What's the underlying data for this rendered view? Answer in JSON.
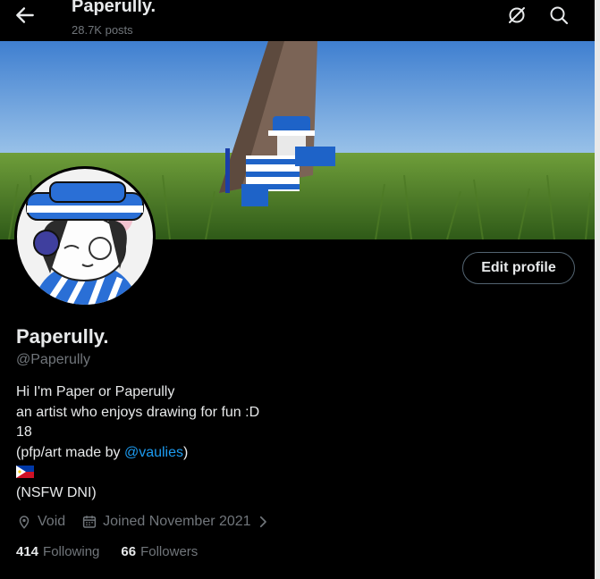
{
  "header": {
    "title": "Paperully.",
    "post_count": "28.7K posts"
  },
  "profile": {
    "display_name": "Paperully.",
    "handle": "@Paperully",
    "edit_label": "Edit profile",
    "bio": {
      "line1": "Hi I'm Paper or Paperully",
      "line2": "an artist who enjoys drawing for fun :D",
      "line3": "18",
      "line4_prefix": "(pfp/art made by ",
      "line4_mention": "@vaulies",
      "line4_suffix": ")",
      "line6": "(NSFW DNI)"
    },
    "location": "Void",
    "joined": "Joined November 2021",
    "following_count": "414",
    "following_label": "Following",
    "followers_count": "66",
    "followers_label": "Followers"
  },
  "icons": {
    "back": "arrow-left-icon",
    "grok": "slash-circle-icon",
    "search": "search-icon",
    "location": "location-pin-icon",
    "calendar": "calendar-icon",
    "chevron": "chevron-right-icon",
    "flag": "philippines-flag"
  },
  "colors": {
    "background": "#000000",
    "text": "#e7e9ea",
    "secondary": "#71767b",
    "mention": "#1d9bf0"
  }
}
